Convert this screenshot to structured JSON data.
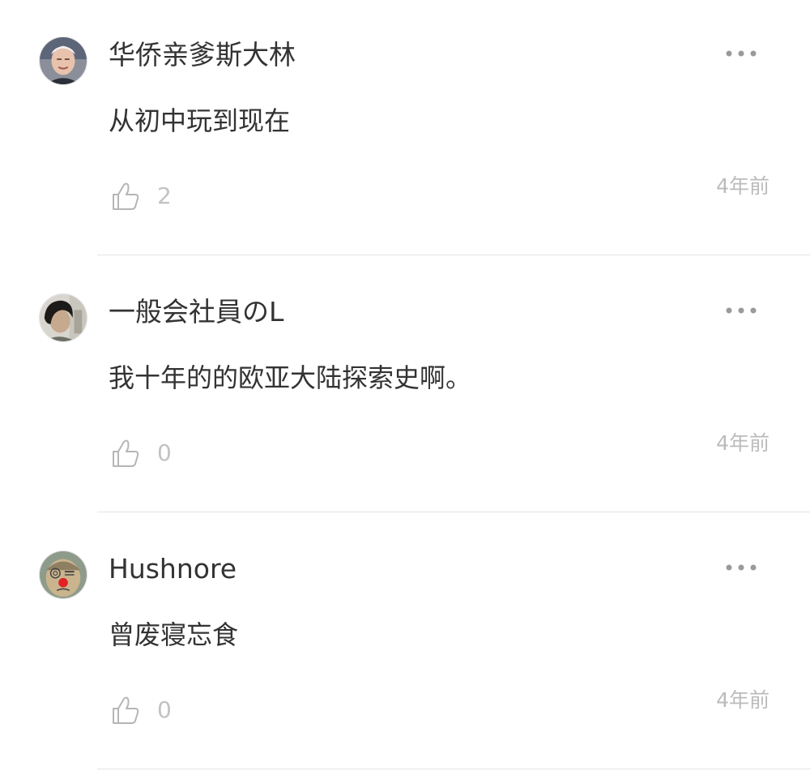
{
  "comments": [
    {
      "username": "华侨亲爹斯大林",
      "content": "从初中玩到现在",
      "likes": "2",
      "time": "4年前",
      "avatar_icon": "avatar-elderly-man-photo"
    },
    {
      "username": "一般会社員のL",
      "content": "我十年的的欧亚大陆探索史啊。",
      "likes": "0",
      "time": "4年前",
      "avatar_icon": "avatar-dark-hair-photo"
    },
    {
      "username": "Hushnore",
      "content": "曾废寝忘食",
      "likes": "0",
      "time": "4年前",
      "avatar_icon": "avatar-cartoon-red-nose"
    }
  ],
  "icons": {
    "more": "more-dots-icon",
    "like": "thumbs-up-icon"
  },
  "colors": {
    "text": "#333333",
    "secondary": "#bbbbbb",
    "divider": "#e3e3e3"
  }
}
